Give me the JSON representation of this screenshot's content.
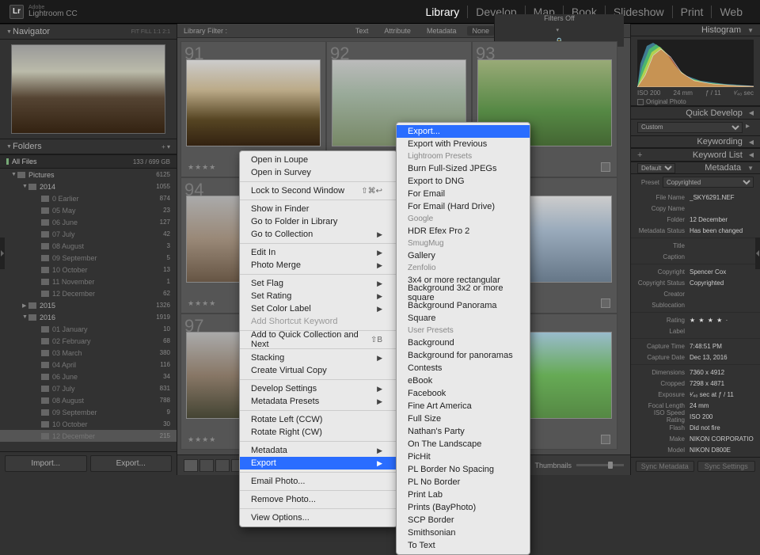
{
  "app": {
    "brand_top": "Adobe",
    "brand_bottom": "Lightroom CC"
  },
  "modules": [
    "Library",
    "Develop",
    "Map",
    "Book",
    "Slideshow",
    "Print",
    "Web"
  ],
  "navigator": {
    "title": "Navigator",
    "extras": "FIT   FILL   1:1   2:1"
  },
  "folders": {
    "title": "Folders",
    "allfiles_label": "All Files",
    "allfiles_size": "133 / 699 GB",
    "tree": [
      {
        "d": 0,
        "name": "Pictures",
        "cnt": "6125",
        "exp": true
      },
      {
        "d": 1,
        "name": "2014",
        "cnt": "1055",
        "exp": true
      },
      {
        "d": 2,
        "name": "0 Earlier",
        "cnt": "874"
      },
      {
        "d": 2,
        "name": "05 May",
        "cnt": "23"
      },
      {
        "d": 2,
        "name": "06 June",
        "cnt": "127"
      },
      {
        "d": 2,
        "name": "07 July",
        "cnt": "42"
      },
      {
        "d": 2,
        "name": "08 August",
        "cnt": "3"
      },
      {
        "d": 2,
        "name": "09 September",
        "cnt": "5"
      },
      {
        "d": 2,
        "name": "10 October",
        "cnt": "13"
      },
      {
        "d": 2,
        "name": "11 November",
        "cnt": "1"
      },
      {
        "d": 2,
        "name": "12 December",
        "cnt": "62"
      },
      {
        "d": 1,
        "name": "2015",
        "cnt": "1326",
        "exp": false
      },
      {
        "d": 1,
        "name": "2016",
        "cnt": "1919",
        "exp": true
      },
      {
        "d": 2,
        "name": "01 January",
        "cnt": "10"
      },
      {
        "d": 2,
        "name": "02 February",
        "cnt": "68"
      },
      {
        "d": 2,
        "name": "03 March",
        "cnt": "380"
      },
      {
        "d": 2,
        "name": "04 April",
        "cnt": "116"
      },
      {
        "d": 2,
        "name": "06 June",
        "cnt": "34"
      },
      {
        "d": 2,
        "name": "07 July",
        "cnt": "831"
      },
      {
        "d": 2,
        "name": "08 August",
        "cnt": "788"
      },
      {
        "d": 2,
        "name": "09 September",
        "cnt": "9"
      },
      {
        "d": 2,
        "name": "10 October",
        "cnt": "30"
      },
      {
        "d": 2,
        "name": "12 December",
        "cnt": "215",
        "sel": true
      }
    ],
    "import_btn": "Import...",
    "export_btn": "Export..."
  },
  "filterbar": {
    "label": "Library Filter :",
    "opts": [
      "Text",
      "Attribute",
      "Metadata",
      "None"
    ],
    "off": "Filters Off"
  },
  "grid_start": 91,
  "toolbar": {
    "thumb_label": "Thumbnails"
  },
  "right": {
    "histogram": "Histogram",
    "histo_info": {
      "iso": "ISO 200",
      "fl": "24 mm",
      "ap": "ƒ / 11",
      "ss": "¹⁄₄₀ sec"
    },
    "original": "Original Photo",
    "quickdev": "Quick Develop",
    "custom": "Custom",
    "keywording": "Keywording",
    "keywordlist": "Keyword List",
    "metadata": "Metadata",
    "default": "Default",
    "preset_lbl": "Preset",
    "preset_val": "Copyrighted",
    "meta": [
      {
        "k": "File Name",
        "v": "_SKY6291.NEF"
      },
      {
        "k": "Copy Name",
        "v": ""
      },
      {
        "k": "Folder",
        "v": "12 December"
      },
      {
        "k": "Metadata Status",
        "v": "Has been changed"
      }
    ],
    "meta2": [
      {
        "k": "Title",
        "v": ""
      },
      {
        "k": "Caption",
        "v": ""
      }
    ],
    "meta3": [
      {
        "k": "Copyright",
        "v": "Spencer Cox"
      },
      {
        "k": "Copyright Status",
        "v": "Copyrighted"
      },
      {
        "k": "Creator",
        "v": ""
      },
      {
        "k": "Sublocation",
        "v": ""
      }
    ],
    "rating_lbl": "Rating",
    "rating_val": "★ ★ ★ ★ ·",
    "label_lbl": "Label",
    "meta4": [
      {
        "k": "Capture Time",
        "v": "7:48:51 PM"
      },
      {
        "k": "Capture Date",
        "v": "Dec 13, 2016"
      }
    ],
    "meta5": [
      {
        "k": "Dimensions",
        "v": "7360 x 4912"
      },
      {
        "k": "Cropped",
        "v": "7298 x 4871"
      },
      {
        "k": "Exposure",
        "v": "¹⁄₄₀ sec at ƒ / 11"
      },
      {
        "k": "Focal Length",
        "v": "24 mm"
      },
      {
        "k": "ISO Speed Rating",
        "v": "ISO 200"
      },
      {
        "k": "Flash",
        "v": "Did not fire"
      },
      {
        "k": "Make",
        "v": "NIKON CORPORATION"
      },
      {
        "k": "Model",
        "v": "NIKON D800E"
      }
    ],
    "sync_meta": "Sync Metadata",
    "sync_set": "Sync Settings"
  },
  "ctx1": [
    {
      "t": "Open in Loupe"
    },
    {
      "t": "Open in Survey"
    },
    {
      "hr": true
    },
    {
      "t": "Lock to Second Window",
      "sc": "⇧⌘↩"
    },
    {
      "hr": true
    },
    {
      "t": "Show in Finder"
    },
    {
      "t": "Go to Folder in Library"
    },
    {
      "t": "Go to Collection",
      "sub": true
    },
    {
      "hr": true
    },
    {
      "t": "Edit In",
      "sub": true
    },
    {
      "t": "Photo Merge",
      "sub": true
    },
    {
      "hr": true
    },
    {
      "t": "Set Flag",
      "sub": true
    },
    {
      "t": "Set Rating",
      "sub": true
    },
    {
      "t": "Set Color Label",
      "sub": true
    },
    {
      "t": "Add Shortcut Keyword",
      "dis": true
    },
    {
      "hr": true
    },
    {
      "t": "Add to Quick Collection and Next",
      "sc": "⇧B"
    },
    {
      "hr": true
    },
    {
      "t": "Stacking",
      "sub": true
    },
    {
      "t": "Create Virtual Copy"
    },
    {
      "hr": true
    },
    {
      "t": "Develop Settings",
      "sub": true
    },
    {
      "t": "Metadata Presets",
      "sub": true
    },
    {
      "hr": true
    },
    {
      "t": "Rotate Left (CCW)"
    },
    {
      "t": "Rotate Right (CW)"
    },
    {
      "hr": true
    },
    {
      "t": "Metadata",
      "sub": true
    },
    {
      "t": "Export",
      "sub": true,
      "sel": true
    },
    {
      "hr": true
    },
    {
      "t": "Email Photo..."
    },
    {
      "hr": true
    },
    {
      "t": "Remove Photo..."
    },
    {
      "hr": true
    },
    {
      "t": "View Options..."
    }
  ],
  "ctx2": [
    {
      "t": "Export...",
      "sel": true
    },
    {
      "t": "Export with Previous"
    },
    {
      "hdr": "Lightroom Presets"
    },
    {
      "t": "Burn Full-Sized JPEGs"
    },
    {
      "t": "Export to DNG"
    },
    {
      "t": "For Email"
    },
    {
      "t": "For Email (Hard Drive)"
    },
    {
      "hdr": "Google"
    },
    {
      "t": "HDR Efex Pro 2"
    },
    {
      "hdr": "SmugMug"
    },
    {
      "t": "Gallery"
    },
    {
      "hdr": "Zenfolio"
    },
    {
      "t": "3x4 or more rectangular"
    },
    {
      "t": "Background 3x2 or more square"
    },
    {
      "t": "Background Panorama"
    },
    {
      "t": "Square"
    },
    {
      "hdr": "User Presets"
    },
    {
      "t": "Background"
    },
    {
      "t": "Background for panoramas"
    },
    {
      "t": "Contests"
    },
    {
      "t": "eBook"
    },
    {
      "t": "Facebook"
    },
    {
      "t": "Fine Art America"
    },
    {
      "t": "Full Size"
    },
    {
      "t": "Nathan's Party"
    },
    {
      "t": "On The Landscape"
    },
    {
      "t": "PicHit"
    },
    {
      "t": "PL Border No Spacing"
    },
    {
      "t": "PL No Border"
    },
    {
      "t": "Print Lab"
    },
    {
      "t": "Prints (BayPhoto)"
    },
    {
      "t": "SCP Border"
    },
    {
      "t": "Smithsonian"
    },
    {
      "t": "To Text"
    }
  ]
}
